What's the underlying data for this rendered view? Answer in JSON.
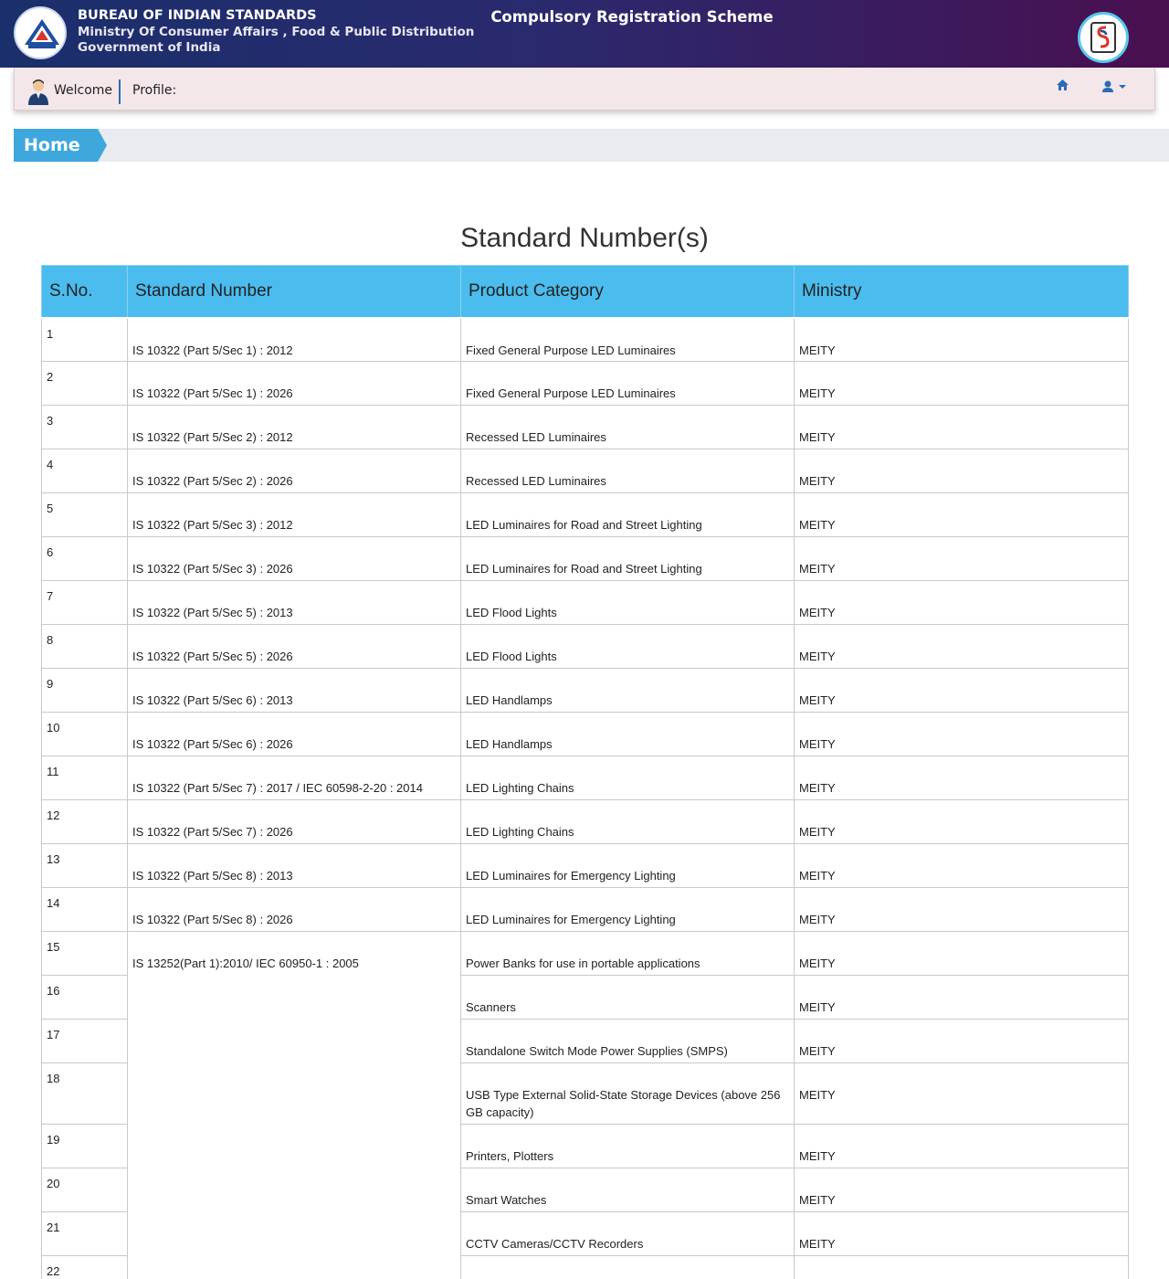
{
  "header": {
    "org_name": "BUREAU OF INDIAN STANDARDS",
    "ministry": "Ministry Of Consumer Affairs , Food & Public Distribution",
    "government": "Government of India",
    "scheme_title": "Compulsory Registration Scheme"
  },
  "nav": {
    "welcome": "Welcome",
    "profile": "Profile:"
  },
  "breadcrumb": {
    "home": "Home"
  },
  "page_title": "Standard Number(s)",
  "table": {
    "headers": [
      "S.No.",
      "Standard Number",
      "Product Category",
      "Ministry"
    ],
    "rows": [
      {
        "sno": "1",
        "standard": "IS 10322 (Part 5/Sec 1) : 2012",
        "category": "Fixed General Purpose LED Luminaires",
        "ministry": "MEITY"
      },
      {
        "sno": "2",
        "standard": "IS 10322 (Part 5/Sec 1) : 2026",
        "category": "Fixed General Purpose LED Luminaires",
        "ministry": "MEITY"
      },
      {
        "sno": "3",
        "standard": "IS 10322 (Part 5/Sec 2) : 2012",
        "category": "Recessed LED Luminaires",
        "ministry": "MEITY"
      },
      {
        "sno": "4",
        "standard": "IS 10322 (Part 5/Sec 2) : 2026",
        "category": "Recessed LED Luminaires",
        "ministry": "MEITY"
      },
      {
        "sno": "5",
        "standard": "IS 10322 (Part 5/Sec 3) : 2012",
        "category": "LED Luminaires for Road and Street Lighting",
        "ministry": "MEITY"
      },
      {
        "sno": "6",
        "standard": "IS 10322 (Part 5/Sec 3) : 2026",
        "category": "LED Luminaires for Road and Street Lighting",
        "ministry": "MEITY"
      },
      {
        "sno": "7",
        "standard": "IS 10322 (Part 5/Sec 5) : 2013",
        "category": "LED Flood Lights",
        "ministry": "MEITY"
      },
      {
        "sno": "8",
        "standard": "IS 10322 (Part 5/Sec 5) : 2026",
        "category": "LED Flood Lights",
        "ministry": "MEITY"
      },
      {
        "sno": "9",
        "standard": "IS 10322 (Part 5/Sec 6) : 2013",
        "category": "LED Handlamps",
        "ministry": "MEITY"
      },
      {
        "sno": "10",
        "standard": "IS 10322 (Part 5/Sec 6) : 2026",
        "category": "LED Handlamps",
        "ministry": "MEITY"
      },
      {
        "sno": "11",
        "standard": "IS 10322 (Part 5/Sec 7) : 2017 / IEC 60598-2-20 : 2014",
        "category": "LED Lighting Chains",
        "ministry": "MEITY"
      },
      {
        "sno": "12",
        "standard": "IS 10322 (Part 5/Sec 7) : 2026",
        "category": "LED Lighting Chains",
        "ministry": "MEITY"
      },
      {
        "sno": "13",
        "standard": "IS 10322 (Part 5/Sec 8) : 2013",
        "category": "LED Luminaires for Emergency Lighting",
        "ministry": "MEITY"
      },
      {
        "sno": "14",
        "standard": "IS 10322 (Part 5/Sec 8) : 2026",
        "category": "LED Luminaires for Emergency Lighting",
        "ministry": "MEITY"
      },
      {
        "sno": "15",
        "standard": "IS 13252(Part 1):2010/ IEC 60950-1 : 2005",
        "category": "Power Banks for use in portable applications",
        "ministry": "MEITY"
      },
      {
        "sno": "16",
        "category": "Scanners",
        "ministry": "MEITY"
      },
      {
        "sno": "17",
        "category": "Standalone Switch Mode Power Supplies (SMPS)",
        "ministry": "MEITY"
      },
      {
        "sno": "18",
        "category": "USB Type External Solid-State Storage Devices (above 256 GB capacity)",
        "ministry": "MEITY"
      },
      {
        "sno": "19",
        "category": "Printers, Plotters",
        "ministry": "MEITY"
      },
      {
        "sno": "20",
        "category": "Smart Watches",
        "ministry": "MEITY"
      },
      {
        "sno": "21",
        "category": "CCTV Cameras/CCTV Recorders",
        "ministry": "MEITY"
      },
      {
        "sno": "22",
        "category": "",
        "ministry": ""
      }
    ]
  }
}
